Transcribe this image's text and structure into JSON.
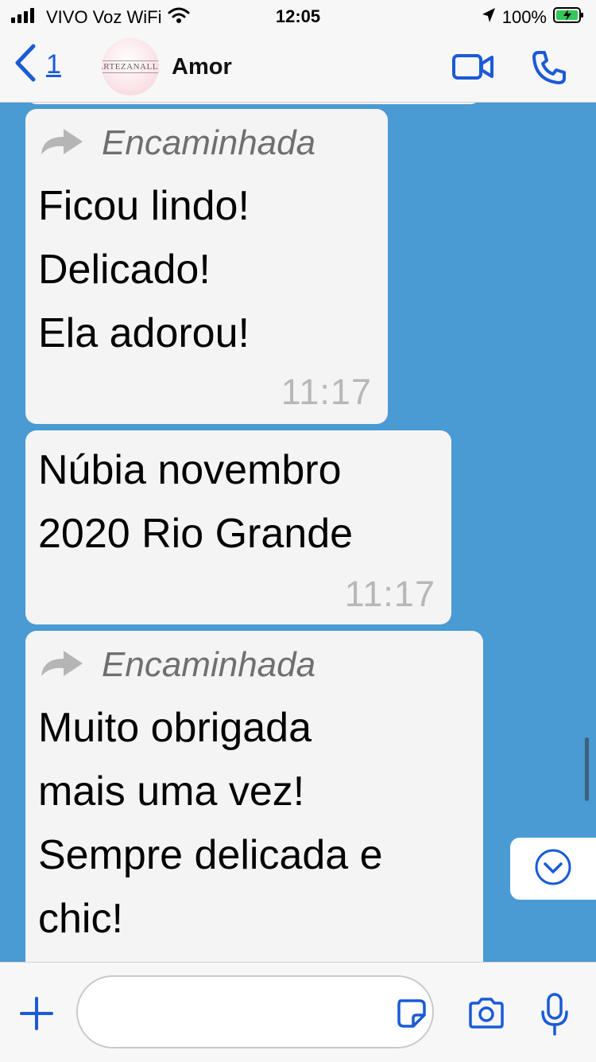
{
  "status_bar": {
    "carrier": "VIVO Voz WiFi",
    "time": "12:05",
    "battery": "100%",
    "icons": [
      "signal-icon",
      "wifi-icon",
      "location-icon",
      "battery-charging-icon"
    ]
  },
  "header": {
    "back_count": "1",
    "contact_name": "Amor",
    "avatar_text": "ARTEZANALLE",
    "icons": [
      "back-chevron-icon",
      "video-call-icon",
      "phone-icon"
    ]
  },
  "messages": [
    {
      "forwarded_label": "Encaminhada",
      "text": "Ficou lindo!\nDelicado!\nEla adorou!",
      "time": "11:17"
    },
    {
      "text": "Núbia novembro\n2020 Rio Grande",
      "time": "11:17"
    },
    {
      "forwarded_label": "Encaminhada",
      "text": "Muito obrigada\nmais uma vez!\nSempre delicada e\nchic!\nT"
    }
  ],
  "composer": {
    "placeholder": "",
    "icons": [
      "plus-icon",
      "sticker-icon",
      "camera-icon",
      "microphone-icon"
    ]
  },
  "colors": {
    "chat_background": "#4a9ad3",
    "accent": "#1a5bd6",
    "bubble": "#f4f4f4"
  }
}
